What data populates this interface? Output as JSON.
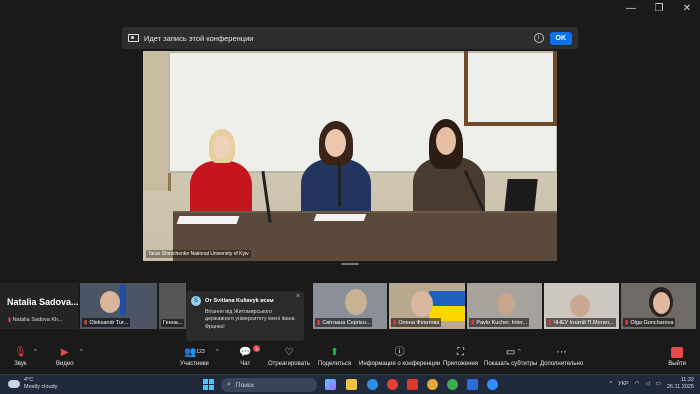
{
  "window": {
    "minimize": "—",
    "restore": "❐",
    "close": "✕"
  },
  "recording": {
    "text": "Идет запись этой конференции",
    "info": "i",
    "ok": "OK"
  },
  "main_video": {
    "caption": "Taras Shevchenko National University of Kyiv"
  },
  "self_card": {
    "name": "Natalia  Sadova...",
    "label": "Natalia Sadova Kh..."
  },
  "participants": [
    {
      "name": "Oleksandr Tur..."
    },
    {
      "name": "Генна..."
    },
    {
      "name": "Світлана Сергієн..."
    },
    {
      "name": "Олена Філатова"
    },
    {
      "name": "Pavlo Kucher. Inter..."
    },
    {
      "name": "ЧНЕУ Ігнатій П.Могил..."
    },
    {
      "name": "Olga Goncharova"
    }
  ],
  "chat_popup": {
    "from": "От Svitlana Kuliavyk всем",
    "message": "Вітання від Житомирського державного університету імені Івана Франка!",
    "close": "×"
  },
  "toolbar": {
    "audio": "Звук",
    "video": "Видео",
    "participants": "Участники",
    "participants_count": "123",
    "chat": "Чат",
    "chat_badge": "1",
    "react": "Отреагировать",
    "share": "Поделиться",
    "info": "Информация о конференции",
    "apps": "Приложения",
    "captions": "Показать субтитры",
    "more": "Дополнительно",
    "exit": "Выйти"
  },
  "taskbar": {
    "temperature": "4°C",
    "weather": "Mostly cloudy",
    "search_placeholder": "Поиск",
    "language": "УКР",
    "time": "11:32",
    "date": "26.11.2025"
  },
  "colors": {
    "accent": "#0e71eb",
    "mute": "#e5484d",
    "share": "#2fbf5d"
  }
}
